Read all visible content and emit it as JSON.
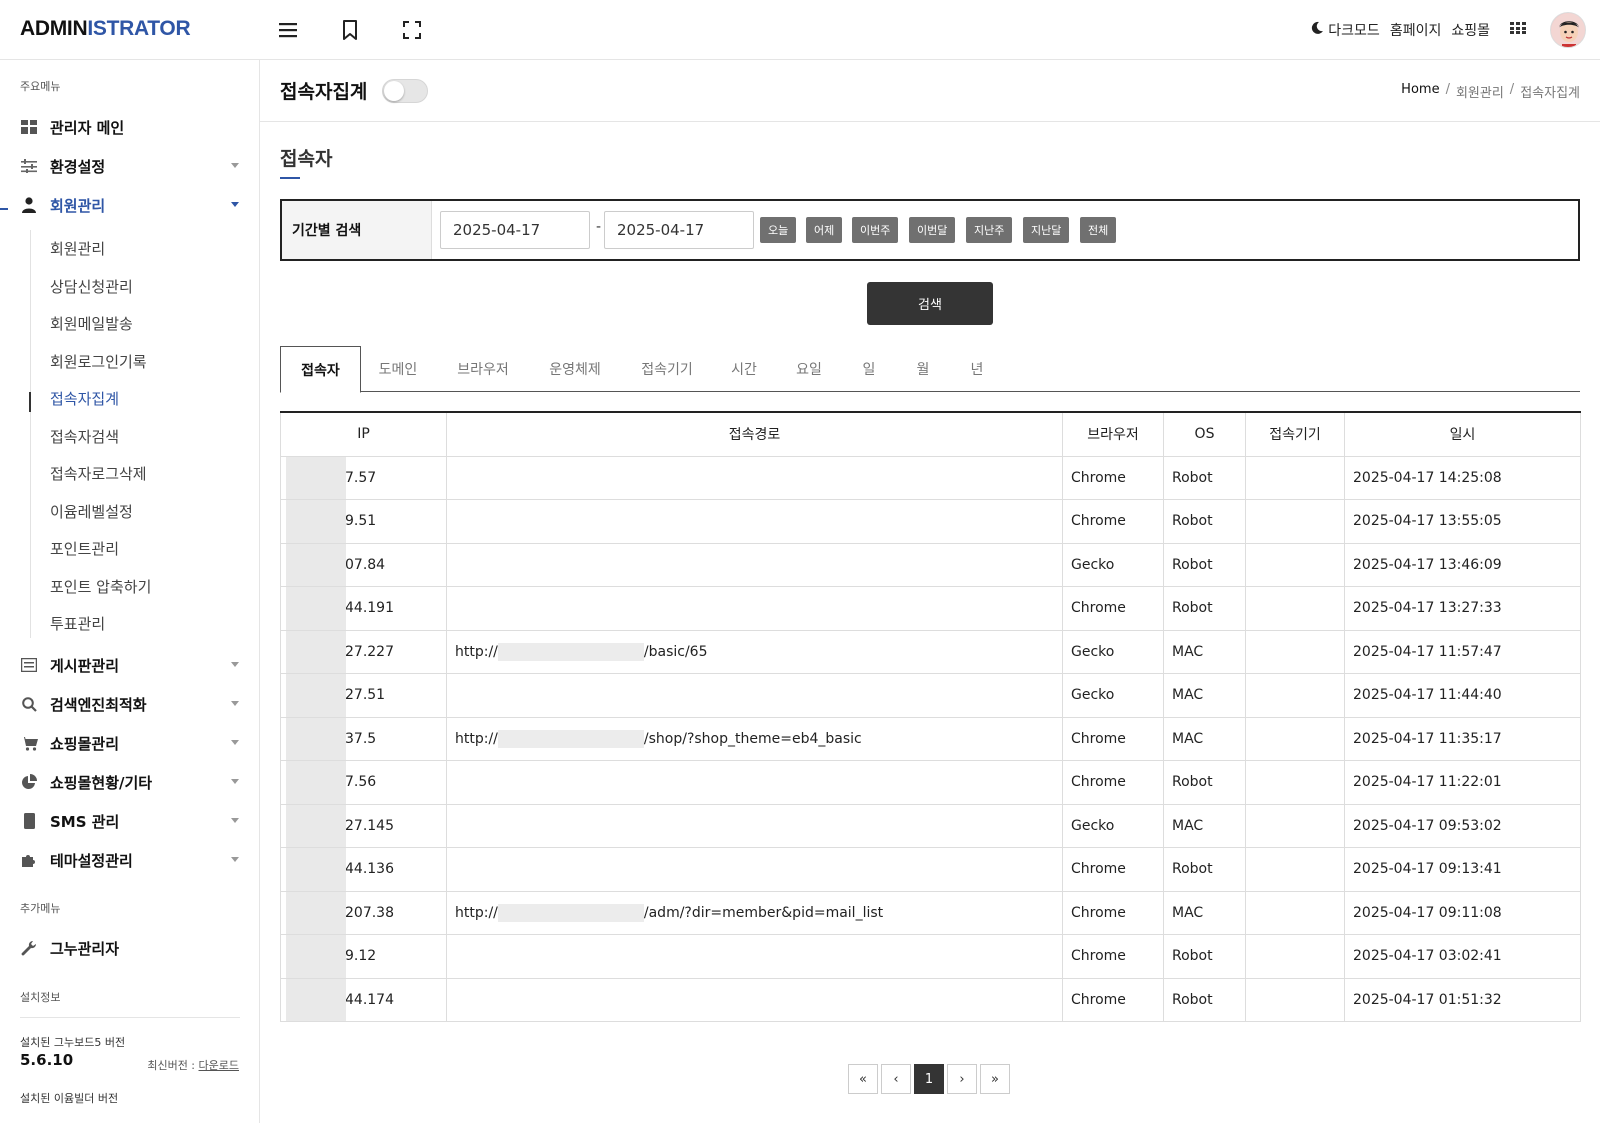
{
  "logo": {
    "part1": "ADMIN",
    "part2": "ISTRATOR"
  },
  "topbar": {
    "icons": [
      "menu-icon",
      "bookmark-icon",
      "fullscreen-icon"
    ],
    "darkmode_label": "다크모드",
    "homepage_label": "홈페이지",
    "shop_label": "쇼핑몰"
  },
  "sidebar": {
    "main_label": "주요메뉴",
    "items": [
      {
        "label": "관리자 메인",
        "icon": "dashboard-icon"
      },
      {
        "label": "환경설정",
        "icon": "sliders-icon"
      },
      {
        "label": "회원관리",
        "icon": "user-icon"
      },
      {
        "label": "게시판관리",
        "icon": "list-icon"
      },
      {
        "label": "검색엔진최적화",
        "icon": "search-icon"
      },
      {
        "label": "쇼핑몰관리",
        "icon": "cart-icon"
      },
      {
        "label": "쇼핑몰현황/기타",
        "icon": "pie-chart-icon"
      },
      {
        "label": "SMS 관리",
        "icon": "phone-icon"
      },
      {
        "label": "테마설정관리",
        "icon": "puzzle-icon"
      }
    ],
    "sub_items": [
      "회원관리",
      "상담신청관리",
      "회원메일발송",
      "회원로그인기록",
      "접속자집계",
      "접속자검색",
      "접속자로그삭제",
      "이윰레벨설정",
      "포인트관리",
      "포인트 압축하기",
      "투표관리"
    ],
    "extra_label": "추가메뉴",
    "extra_item": {
      "label": "그누관리자",
      "icon": "wrench-icon"
    },
    "install_label": "설치정보",
    "gnuboard_label": "설치된 그누보드5 버전",
    "gnuboard_version": "5.6.10",
    "latest_label": "최신버전 :",
    "download_label": "다운로드",
    "eyoom_label": "설치된 이윰빌더 버전"
  },
  "page": {
    "title": "접속자집계",
    "breadcrumb": {
      "home": "Home",
      "sep": "/",
      "level1": "회원관리",
      "level2": "접속자집계"
    },
    "section_title": "접속자"
  },
  "search": {
    "label": "기간별 검색",
    "from": "2025-04-17",
    "to": "2025-04-17",
    "dash": "-",
    "quick": [
      "오늘",
      "어제",
      "이번주",
      "이번달",
      "지난주",
      "지난달",
      "전체"
    ],
    "button": "검색"
  },
  "tabs": [
    "접속자",
    "도메인",
    "브라우저",
    "운영체제",
    "접속기기",
    "시간",
    "요일",
    "일",
    "월",
    "년"
  ],
  "table": {
    "headers": [
      "IP",
      "접속경로",
      "브라우저",
      "OS",
      "접속기기",
      "일시"
    ],
    "rows": [
      {
        "ip": "7.57",
        "url_prefix": "",
        "url_suffix": "",
        "browser": "Chrome",
        "os": "Robot",
        "device": "",
        "datetime": "2025-04-17 14:25:08"
      },
      {
        "ip": "9.51",
        "url_prefix": "",
        "url_suffix": "",
        "browser": "Chrome",
        "os": "Robot",
        "device": "",
        "datetime": "2025-04-17 13:55:05"
      },
      {
        "ip": "07.84",
        "url_prefix": "",
        "url_suffix": "",
        "browser": "Gecko",
        "os": "Robot",
        "device": "",
        "datetime": "2025-04-17 13:46:09"
      },
      {
        "ip": "44.191",
        "url_prefix": "",
        "url_suffix": "",
        "browser": "Chrome",
        "os": "Robot",
        "device": "",
        "datetime": "2025-04-17 13:27:33"
      },
      {
        "ip": "27.227",
        "url_prefix": "http://",
        "url_suffix": "/basic/65",
        "browser": "Gecko",
        "os": "MAC",
        "device": "",
        "datetime": "2025-04-17 11:57:47"
      },
      {
        "ip": "27.51",
        "url_prefix": "",
        "url_suffix": "",
        "browser": "Gecko",
        "os": "MAC",
        "device": "",
        "datetime": "2025-04-17 11:44:40"
      },
      {
        "ip": "37.5",
        "url_prefix": "http://",
        "url_suffix": "/shop/?shop_theme=eb4_basic",
        "browser": "Chrome",
        "os": "MAC",
        "device": "",
        "datetime": "2025-04-17 11:35:17"
      },
      {
        "ip": "7.56",
        "url_prefix": "",
        "url_suffix": "",
        "browser": "Chrome",
        "os": "Robot",
        "device": "",
        "datetime": "2025-04-17 11:22:01"
      },
      {
        "ip": "27.145",
        "url_prefix": "",
        "url_suffix": "",
        "browser": "Gecko",
        "os": "MAC",
        "device": "",
        "datetime": "2025-04-17 09:53:02"
      },
      {
        "ip": "44.136",
        "url_prefix": "",
        "url_suffix": "",
        "browser": "Chrome",
        "os": "Robot",
        "device": "",
        "datetime": "2025-04-17 09:13:41"
      },
      {
        "ip": "207.38",
        "url_prefix": "http://",
        "url_suffix": "/adm/?dir=member&pid=mail_list",
        "browser": "Chrome",
        "os": "MAC",
        "device": "",
        "datetime": "2025-04-17 09:11:08"
      },
      {
        "ip": "9.12",
        "url_prefix": "",
        "url_suffix": "",
        "browser": "Chrome",
        "os": "Robot",
        "device": "",
        "datetime": "2025-04-17 03:02:41"
      },
      {
        "ip": "44.174",
        "url_prefix": "",
        "url_suffix": "",
        "browser": "Chrome",
        "os": "Robot",
        "device": "",
        "datetime": "2025-04-17 01:51:32"
      }
    ]
  },
  "pagination": {
    "first": "«",
    "prev": "‹",
    "current": "1",
    "next": "›",
    "last": "»"
  },
  "colors": {
    "accent": "#2f56a6",
    "dark_button": "#343434",
    "quick_button": "#707070"
  }
}
